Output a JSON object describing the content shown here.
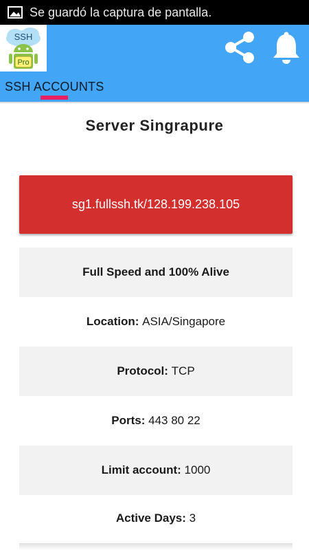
{
  "status_bar": {
    "notification_icon": "image-icon",
    "text": "Se guardó la captura de pantalla."
  },
  "app_bar": {
    "logo": {
      "top_text": "SSH",
      "bottom_text": "Pro"
    },
    "actions": [
      "share-icon",
      "bell-icon"
    ],
    "color": "#42a5f5"
  },
  "tabs": [
    {
      "label": "SSH ACCOUNTS",
      "active": true
    }
  ],
  "accent_color": "#e91e63",
  "server": {
    "title": "Server Singrapure",
    "host": "sg1.fullssh.tk/128.199.238.105",
    "host_button_color": "#d32f2f",
    "status": "Full Speed and 100% Alive",
    "details": [
      {
        "key": "Location:",
        "value": "ASIA/Singapore"
      },
      {
        "key": "Protocol:",
        "value": "TCP"
      },
      {
        "key": "Ports:",
        "value": "443 80 22"
      },
      {
        "key": "Limit account:",
        "value": "1000"
      },
      {
        "key": "Active Days:",
        "value": "3"
      }
    ]
  }
}
